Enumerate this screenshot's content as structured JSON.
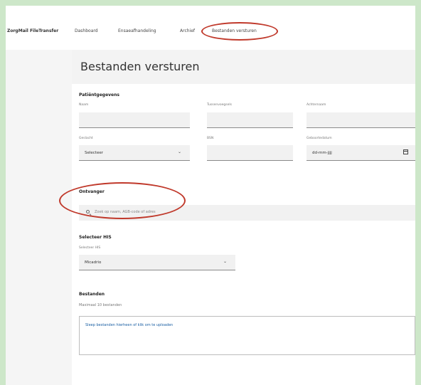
{
  "nav": {
    "brand": "ZorgMail FileTransfer",
    "items": [
      "Dashboard",
      "Ensaeafhandeling",
      "Archief",
      "Bestanden versturen"
    ]
  },
  "page": {
    "title": "Bestanden versturen"
  },
  "patient": {
    "section_title": "Patiëntgegevens",
    "fields": {
      "naam": {
        "label": "Naam"
      },
      "tussenvoegsels": {
        "label": "Tussenvoegsels"
      },
      "achternaam": {
        "label": "Achternaam"
      },
      "geslacht": {
        "label": "Geslacht",
        "value": "Selecteer"
      },
      "bsn": {
        "label": "BSN"
      },
      "geboortedatum": {
        "label": "Geboortedatum",
        "value": "dd-mm-jjjj"
      }
    }
  },
  "recipient": {
    "section_title": "Ontvanger",
    "search_placeholder": "Zoek op naam, AGB-code of adres"
  },
  "his": {
    "section_title": "Selecteer HIS",
    "label": "Selecteer HIS",
    "value": "Micadrio"
  },
  "files": {
    "section_title": "Bestanden",
    "hint": "Maximaal 10 bestanden",
    "dropzone_text": "Sleep bestanden hierheen of klik om te uploaden"
  },
  "colors": {
    "annotation": "#c0392b",
    "link": "#1a5fa3"
  }
}
